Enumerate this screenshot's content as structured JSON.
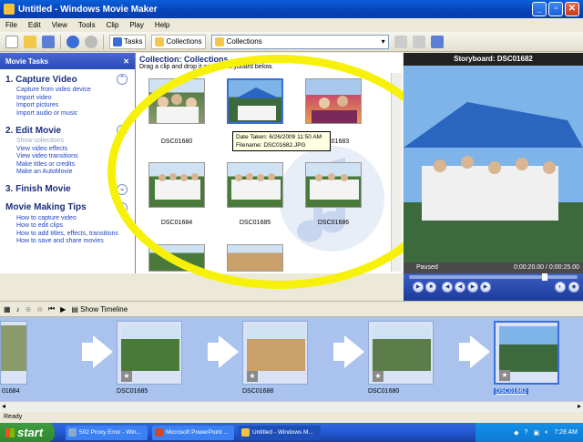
{
  "window": {
    "title": "Untitled - Windows Movie Maker"
  },
  "menu": [
    "File",
    "Edit",
    "View",
    "Tools",
    "Clip",
    "Play",
    "Help"
  ],
  "toolbar": {
    "tasks_label": "Tasks",
    "collections_label": "Collections",
    "collection_select": "Collections"
  },
  "tasks_pane": {
    "header": "Movie Tasks",
    "sections": [
      {
        "title": "1. Capture Video",
        "links": [
          "Capture from video device",
          "Import video",
          "Import pictures",
          "Import audio or music"
        ]
      },
      {
        "title": "2. Edit Movie",
        "links": [
          "Show collections",
          "View video effects",
          "View video transitions",
          "Make titles or credits",
          "Make an AutoMovie"
        ]
      },
      {
        "title": "3. Finish Movie",
        "links": []
      },
      {
        "title": "Movie Making Tips",
        "links": [
          "How to capture video",
          "How to edit clips",
          "How to add titles, effects, transitions",
          "How to save and share movies"
        ]
      }
    ]
  },
  "collection": {
    "title": "Collection: Collections",
    "instruction": "Drag a clip and drop it on the storyboard below.",
    "items": [
      "DSC01680",
      "",
      "DSC01683",
      "DSC01684",
      "DSC01685",
      "DSC01686",
      "",
      ""
    ],
    "tooltip": {
      "line1": "Date Taken: 6/26/2009 11:50 AM",
      "line2": "Filename: DSC01682.JPG"
    }
  },
  "preview": {
    "title": "Storyboard: DSC01682",
    "state": "Paused",
    "time": "0:00:20.00 / 0:00:25.00"
  },
  "storyboard": {
    "show_timeline": "Show Timeline",
    "clips": [
      "01684",
      "DSC01685",
      "DSC01688",
      "DSC01680",
      "DSC01682"
    ]
  },
  "statusbar": {
    "text": "Ready"
  },
  "taskbar": {
    "start": "start",
    "tasks": [
      "502 Proxy Error - Win...",
      "Microsoft PowerPoint ...",
      "Untitled - Windows M..."
    ],
    "clock": "7:28 AM"
  }
}
